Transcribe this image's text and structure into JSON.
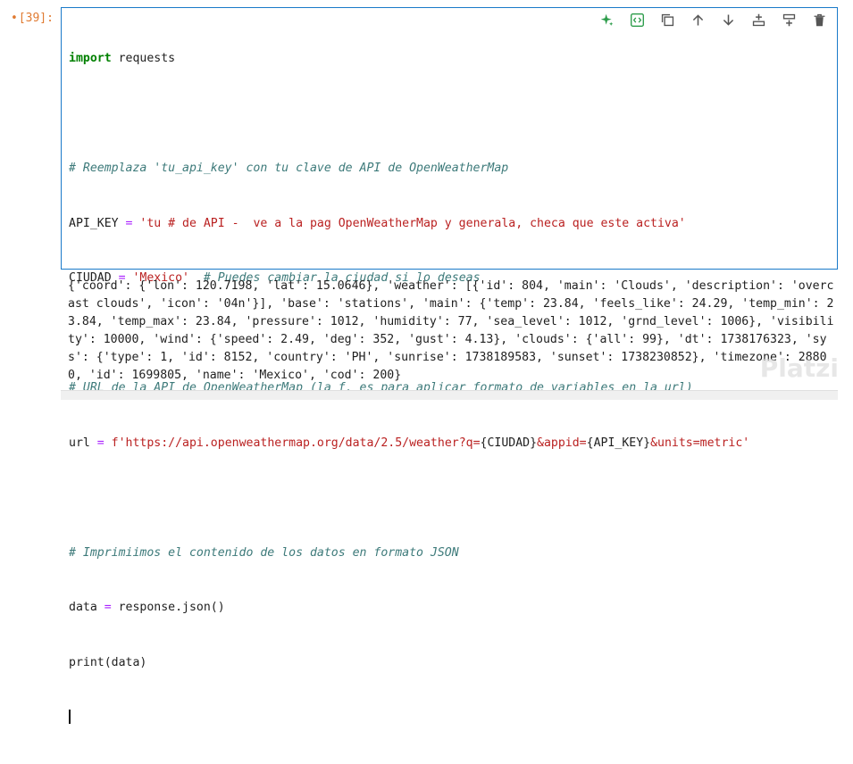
{
  "cell": {
    "prompt_bullet": "•",
    "prompt": "[39]:",
    "lines": {
      "l1_kw": "import",
      "l1_rest": " requests",
      "l2": "",
      "l3": "# Reemplaza 'tu_api_key' con tu clave de API de OpenWeatherMap",
      "l4_a": "API_KEY",
      "l4_eq": " = ",
      "l4_str": "'tu # de API -  ve a la pag OpenWeatherMap y generala, checa que este activa'",
      "l5_a": "CIUDAD",
      "l5_eq": " = ",
      "l5_str": "'Mexico'",
      "l5_cm": "  # Puedes cambiar la ciudad si lo deseas",
      "l6": "",
      "l7": "# URL de la API de OpenWeatherMap (la f, es para aplicar formato de variables en la url)",
      "l8_a": "url",
      "l8_eq": " = ",
      "l8_str1": "f'https://api.openweathermap.org/data/2.5/weather?q=",
      "l8_var1": "{CIUDAD}",
      "l8_str2": "&appid=",
      "l8_var2": "{API_KEY}",
      "l8_str3": "&units=metric'",
      "l9": "",
      "l10": "# Imprimiimos el contenido de los datos en formato JSON",
      "l11_a": "data",
      "l11_eq": " = ",
      "l11_rest": "response.json()",
      "l12": "print(data)"
    }
  },
  "toolbar": {
    "icons": [
      "sparkle-icon",
      "code-toggle-icon",
      "duplicate-icon",
      "move-up-icon",
      "move-down-icon",
      "insert-above-icon",
      "insert-below-icon",
      "delete-icon"
    ]
  },
  "output": {
    "text": "{'coord': {'lon': 120.7198, 'lat': 15.0646}, 'weather': [{'id': 804, 'main': 'Clouds', 'description': 'overcast clouds', 'icon': '04n'}], 'base': 'stations', 'main': {'temp': 23.84, 'feels_like': 24.29, 'temp_min': 23.84, 'temp_max': 23.84, 'pressure': 1012, 'humidity': 77, 'sea_level': 1012, 'grnd_level': 1006}, 'visibility': 10000, 'wind': {'speed': 2.49, 'deg': 352, 'gust': 4.13}, 'clouds': {'all': 99}, 'dt': 1738176323, 'sys': {'type': 1, 'id': 8152, 'country': 'PH', 'sunrise': 1738189583, 'sunset': 1738230852}, 'timezone': 28800, 'id': 1699805, 'name': 'Mexico', 'cod': 200}"
  },
  "watermark": "Platzi",
  "colors": {
    "accent": "#1a7ac9",
    "prompt": "#e07b32",
    "string": "#ba2121",
    "comment": "#3d7a7a",
    "keyword": "#008000"
  }
}
